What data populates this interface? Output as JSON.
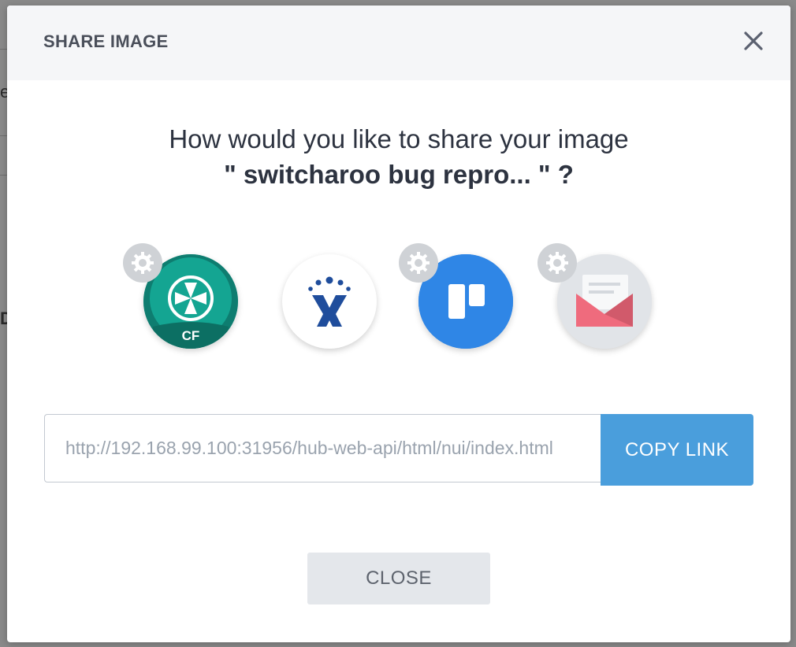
{
  "modal": {
    "title": "SHARE IMAGE",
    "prompt_line1": "How would you like to share your image",
    "prompt_line2": "\" switcharoo bug repro... \" ?"
  },
  "share_targets": [
    {
      "name": "codefresh",
      "badge": "CF",
      "color": "#0a9b88",
      "has_settings": true
    },
    {
      "name": "jira",
      "color": "#ffffff",
      "has_settings": false
    },
    {
      "name": "trello",
      "color": "#2f86e6",
      "has_settings": true
    },
    {
      "name": "email",
      "color": "#e1e4e8",
      "has_settings": true
    }
  ],
  "link": {
    "value": "http://192.168.99.100:31956/hub-web-api/html/nui/index.html",
    "copy_label": "COPY LINK"
  },
  "footer": {
    "close_label": "CLOSE"
  },
  "colors": {
    "accent": "#4a9edc",
    "header_bg": "#f5f6f8",
    "overlay": "#7d7d7d"
  },
  "background": {
    "glyph_1": "e,",
    "glyph_2": "D"
  }
}
